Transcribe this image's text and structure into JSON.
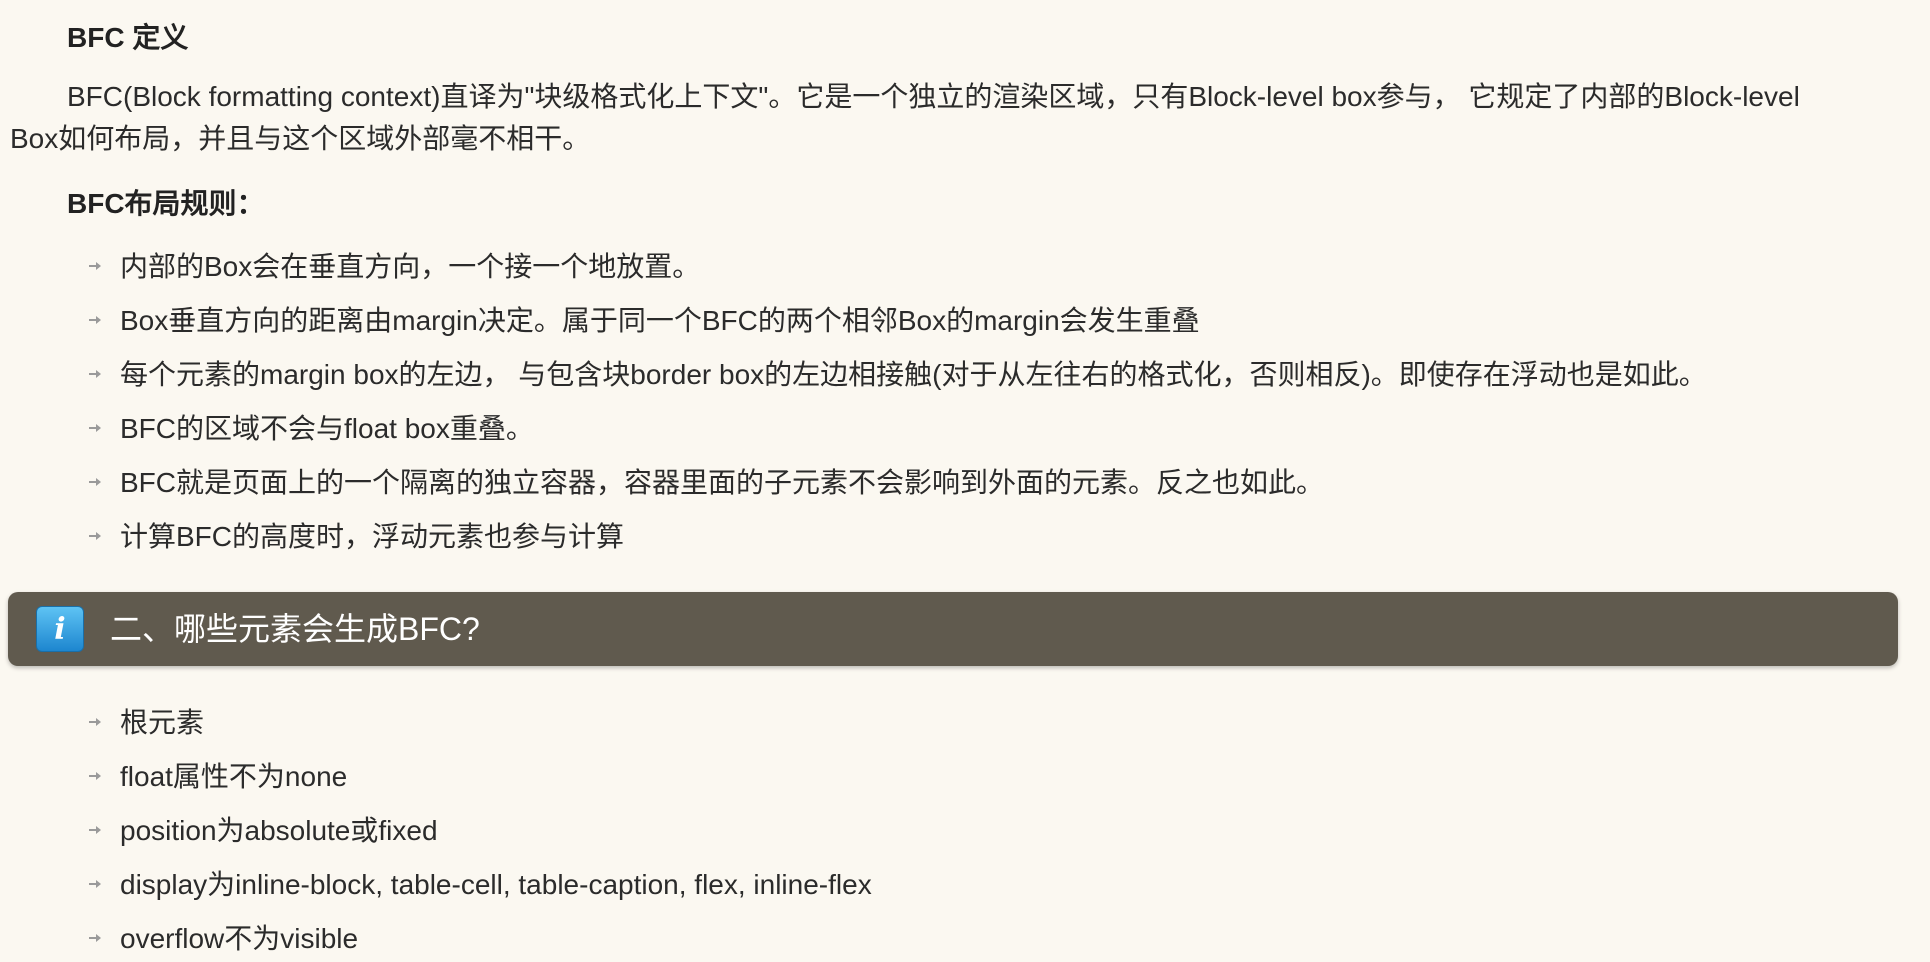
{
  "bfc_definition": {
    "heading": "BFC 定义",
    "paragraph": "BFC(Block formatting context)直译为\"块级格式化上下文\"。它是一个独立的渲染区域，只有Block-level box参与， 它规定了内部的Block-level Box如何布局，并且与这个区域外部毫不相干。"
  },
  "bfc_rules": {
    "heading": "BFC布局规则：",
    "items": [
      "内部的Box会在垂直方向，一个接一个地放置。",
      "Box垂直方向的距离由margin决定。属于同一个BFC的两个相邻Box的margin会发生重叠",
      "每个元素的margin box的左边， 与包含块border box的左边相接触(对于从左往右的格式化，否则相反)。即使存在浮动也是如此。",
      "BFC的区域不会与float box重叠。",
      "BFC就是页面上的一个隔离的独立容器，容器里面的子元素不会影响到外面的元素。反之也如此。",
      "计算BFC的高度时，浮动元素也参与计算"
    ]
  },
  "section_two": {
    "icon": "info-icon",
    "icon_glyph": "i",
    "title": "二、哪些元素会生成BFC?",
    "items": [
      "根元素",
      "float属性不为none",
      "position为absolute或fixed",
      "display为inline-block, table-cell, table-caption, flex, inline-flex",
      "overflow不为visible"
    ]
  },
  "colors": {
    "background": "#fbf8f1",
    "section_bar": "#605a4e",
    "info_icon": "#2a9be0"
  }
}
